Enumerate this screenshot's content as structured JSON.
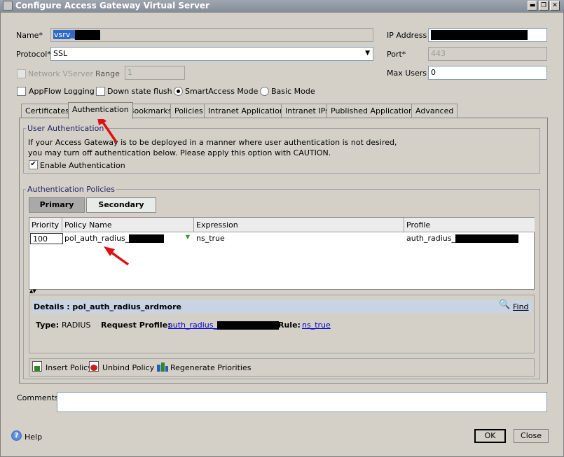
{
  "window": {
    "title": "Configure Access Gateway Virtual Server"
  },
  "form": {
    "name_label": "Name*",
    "name_value": "vsrv_",
    "ip_label": "IP Address",
    "protocol_label": "Protocol*",
    "protocol_value": "SSL",
    "port_label": "Port*",
    "port_value": "443",
    "network_vserver_label": "Network VServer",
    "range_label": "Range",
    "range_value": "1",
    "max_users_label": "Max Users",
    "max_users_value": "0",
    "appflow_label": "AppFlow Logging",
    "down_state_label": "Down state flush",
    "smartaccess_label": "SmartAccess Mode",
    "basic_mode_label": "Basic Mode"
  },
  "tabs": [
    "Certificates",
    "Authentication",
    "Bookmarks",
    "Policies",
    "Intranet Applications",
    "Intranet IPs",
    "Published Applications",
    "Advanced"
  ],
  "user_auth": {
    "title": "User Authentication",
    "text1": "If your Access Gateway is to be deployed in a manner where user authentication is not desired,",
    "text2": "you may turn off authentication below. Please apply this option with CAUTION.",
    "enable_label": "Enable Authentication"
  },
  "auth_policies": {
    "title": "Authentication Policies",
    "primary_label": "Primary",
    "secondary_label": "Secondary",
    "columns": [
      "Priority",
      "Policy Name",
      "Expression",
      "Profile"
    ],
    "row": {
      "priority": "100",
      "policy_name": "pol_auth_radius_",
      "expression": "ns_true",
      "profile": "auth_radius_"
    },
    "details_title": "Details : pol_auth_radius_ardmore",
    "find_label": "Find",
    "type_label": "Type:",
    "type_value": "RADIUS",
    "request_profile_label": "Request Profile:",
    "request_profile_value": "auth_radius_",
    "rule_label": "Rule:",
    "rule_value": "ns_true",
    "insert_label": "Insert Policy",
    "unbind_label": "Unbind Policy",
    "regenerate_label": "Regenerate Priorities"
  },
  "comments_label": "Comments",
  "footer": {
    "help_label": "Help",
    "ok_label": "OK",
    "close_label": "Close"
  },
  "colors": {
    "annotation_arrow": "#e01010",
    "link": "#0000cc"
  },
  "icons": [
    "app-icon",
    "minimize-icon",
    "restore-icon",
    "close-icon",
    "dropdown-arrow-icon",
    "find-icon",
    "insert-policy-icon",
    "unbind-policy-icon",
    "regenerate-icon",
    "help-icon"
  ]
}
